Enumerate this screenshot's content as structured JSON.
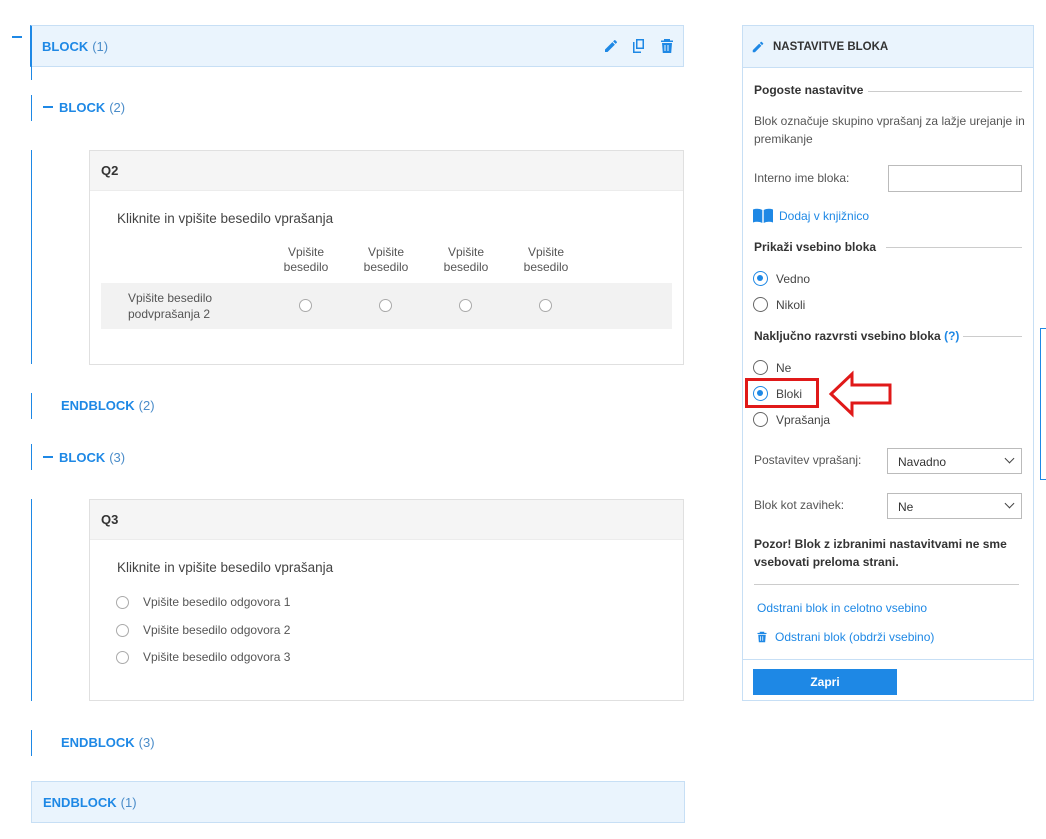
{
  "block1": {
    "keyword": "BLOCK",
    "num": "(1)",
    "end_keyword": "ENDBLOCK",
    "end_num": "(1)"
  },
  "block2": {
    "keyword": "BLOCK",
    "num": "(2)",
    "end_keyword": "ENDBLOCK",
    "end_num": "(2)"
  },
  "block3": {
    "keyword": "BLOCK",
    "num": "(3)",
    "end_keyword": "ENDBLOCK",
    "end_num": "(3)"
  },
  "q2": {
    "id": "Q2",
    "text": "Kliknite in vpišite besedilo vprašanja",
    "columns": [
      "Vpišite besedilo",
      "Vpišite besedilo",
      "Vpišite besedilo",
      "Vpišite besedilo"
    ],
    "row_label": "Vpišite besedilo podvprašanja 2"
  },
  "q3": {
    "id": "Q3",
    "text": "Kliknite in vpišite besedilo vprašanja",
    "options": [
      "Vpišite besedilo odgovora 1",
      "Vpišite besedilo odgovora 2",
      "Vpišite besedilo odgovora 3"
    ]
  },
  "panel": {
    "title": "NASTAVITVE BLOKA",
    "common_title": "Pogoste nastavitve",
    "description": "Blok označuje skupino vprašanj za lažje urejanje in premikanje",
    "internal_name_label": "Interno ime bloka:",
    "internal_name_value": "",
    "add_library": "Dodaj v knjižnico",
    "show_title": "Prikaži vsebino bloka",
    "show_options": [
      "Vedno",
      "Nikoli"
    ],
    "show_selected": "Vedno",
    "random_title": "Naključno razvrsti vsebino bloka",
    "random_help": "(?)",
    "random_options": [
      "Ne",
      "Bloki",
      "Vprašanja"
    ],
    "random_selected": "Bloki",
    "layout_label": "Postavitev vprašanj:",
    "layout_value": "Navadno",
    "tab_label": "Blok kot zavihek:",
    "tab_value": "Ne",
    "warning": "Pozor! Blok z izbranimi nastavitvami ne sme vsebovati preloma strani.",
    "remove_all": "Odstrani blok in celotno vsebino",
    "remove_keep": "Odstrani blok (obdrži vsebino)",
    "close": "Zapri"
  },
  "colors": {
    "accent": "#1e88e5",
    "highlight": "#e01919"
  }
}
